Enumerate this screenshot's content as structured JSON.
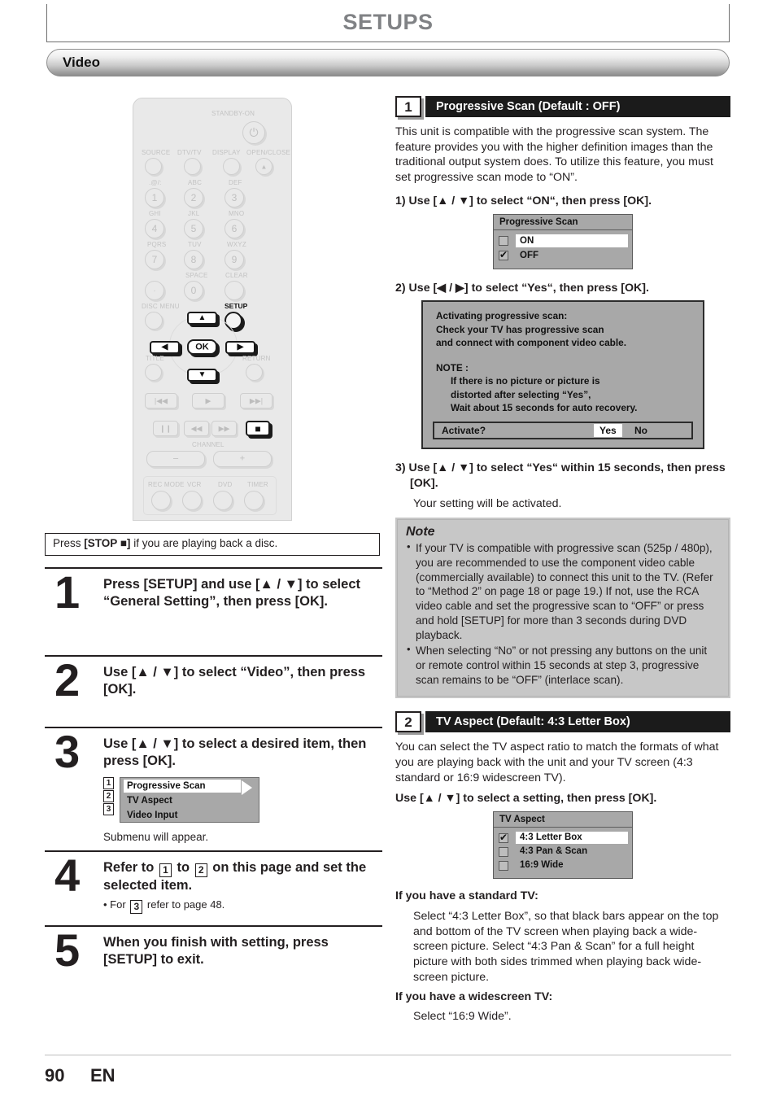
{
  "header": {
    "title": "SETUPS",
    "section": "Video"
  },
  "remote": {
    "labels": {
      "standby": "STANDBY-ON",
      "source": "SOURCE",
      "dtvtv": "DTV/TV",
      "display": "DISPLAY",
      "openclose": "OPEN/CLOSE",
      "k1_sub": ".@/:",
      "k2_sub": "ABC",
      "k3_sub": "DEF",
      "k4_sub": "GHI",
      "k5_sub": "JKL",
      "k6_sub": "MNO",
      "k7_sub": "PQRS",
      "k8_sub": "TUV",
      "k9_sub": "WXYZ",
      "kdot_sub": "SPACE",
      "kclear_sub": "CLEAR",
      "discmenu": "DISC MENU",
      "setup": "SETUP",
      "title_btn": "TITLE",
      "return_btn": "RETURN",
      "ok": "OK",
      "channel": "CHANNEL",
      "ch_minus": "–",
      "ch_plus": "+",
      "recmode": "REC MODE",
      "vcr": "VCR",
      "dvd": "DVD",
      "timer": "TIMER",
      "n1": "1",
      "n2": "2",
      "n3": "3",
      "n4": "4",
      "n5": "5",
      "n6": "6",
      "n7": "7",
      "n8": "8",
      "n9": "9",
      "n0": "0",
      "ndot": "·",
      "up": "▲",
      "down": "▼",
      "left": "◀",
      "right": "▶",
      "power": "⏻",
      "eject": "▲",
      "prev": "|◀◀",
      "play": "▶",
      "next": "▶▶|",
      "pause": "❙❙",
      "rew": "◀◀",
      "ff": "▶▶",
      "stop": "■"
    }
  },
  "left": {
    "stop_note_prefix": "Press ",
    "stop_note_bold": "[STOP ■]",
    "stop_note_suffix": " if you are playing back a disc.",
    "steps": [
      {
        "num": "1",
        "head": "Press [SETUP] and use [▲ / ▼] to select “General Setting”, then press [OK]."
      },
      {
        "num": "2",
        "head": "Use [▲ / ▼] to select “Video”, then press [OK]."
      },
      {
        "num": "3",
        "head": "Use [▲ / ▼] to select a desired item, then press [OK].",
        "sub": "Submenu will appear."
      },
      {
        "num": "4",
        "head_a": "Refer to ",
        "chip_a": "1",
        "head_b": " to ",
        "chip_b": "2",
        "head_c": " on this page and set the selected item.",
        "bullet_a": "• For ",
        "bullet_chip": "3",
        "bullet_b": " refer to page 48."
      },
      {
        "num": "5",
        "head": "When you finish with setting, press [SETUP] to exit."
      }
    ],
    "submenu": {
      "items": [
        {
          "chip": "1",
          "label": "Progressive Scan",
          "selected": true
        },
        {
          "chip": "2",
          "label": "TV Aspect",
          "selected": false
        },
        {
          "chip": "3",
          "label": "Video Input",
          "selected": false
        }
      ]
    }
  },
  "right": {
    "sec1": {
      "num": "1",
      "title": "Progressive Scan (Default : OFF)",
      "body": "This unit is compatible with the progressive scan system. The feature provides you with the higher definition images than the traditional output system does. To utilize this feature, you must set progressive scan mode to “ON”.",
      "step1": "1) Use [▲ / ▼] to select “ON“, then press [OK].",
      "step2": "2) Use [◀ / ▶] to select “Yes“, then press [OK].",
      "step3_bold": "3) Use [▲ / ▼] to select “Yes“ within 15 seconds, then press [OK].",
      "step3_plain": "Your setting will be activated."
    },
    "osd_progressive": {
      "header": "Progressive Scan",
      "items": [
        {
          "label": "ON",
          "checked": false,
          "selected": true
        },
        {
          "label": "OFF",
          "checked": true,
          "selected": false
        }
      ]
    },
    "osd_activate": {
      "line1": "Activating progressive scan:",
      "line2": "Check your TV has progressive scan",
      "line3": "and connect with component video cable.",
      "note_label": "NOTE :",
      "note1": "If there is no picture or picture is",
      "note2": "distorted after selecting     “Yes”,",
      "note3": "Wait about 15 seconds for auto recovery.",
      "question": "Activate?",
      "yes": "Yes",
      "no": "No"
    },
    "note": {
      "title": "Note",
      "bullets": [
        "If your TV is compatible with progressive scan (525p / 480p), you are recommended to use the component video cable (commercially available) to connect this unit to the TV. (Refer to “Method 2” on page 18 or page 19.) If not, use the RCA video cable and set the progressive scan to “OFF” or press and hold [SETUP] for more than 3 seconds during DVD playback.",
        "When selecting “No” or not pressing any buttons on the unit or remote control within 15 seconds at step 3, progressive scan remains to be “OFF” (interlace scan)."
      ]
    },
    "sec2": {
      "num": "2",
      "title": "TV Aspect (Default: 4:3 Letter Box)",
      "body": "You can select the TV aspect ratio to match the formats of what you are playing back with the unit and your TV screen (4:3 standard or 16:9 widescreen TV).",
      "use_line": "Use [▲ / ▼] to select a setting, then press [OK].",
      "std_head": "If you have a standard TV:",
      "std_body": "Select “4:3 Letter Box”, so that black bars appear on the top and bottom of the TV screen when playing back a wide-screen picture. Select “4:3 Pan & Scan” for a full height picture with both sides trimmed when playing back wide-screen picture.",
      "wide_head": "If you have a widescreen TV:",
      "wide_body": "Select “16:9 Wide”."
    },
    "osd_tvaspect": {
      "header": "TV Aspect",
      "items": [
        {
          "label": "4:3 Letter Box",
          "checked": true,
          "selected": true
        },
        {
          "label": "4:3 Pan & Scan",
          "checked": false,
          "selected": false
        },
        {
          "label": "16:9 Wide",
          "checked": false,
          "selected": false
        }
      ]
    }
  },
  "footer": {
    "page": "90",
    "lang": "EN"
  }
}
